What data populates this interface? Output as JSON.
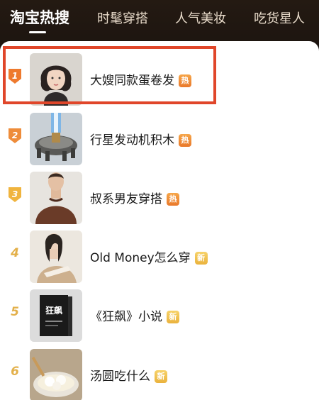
{
  "tabs": [
    {
      "label": "淘宝热搜"
    },
    {
      "label": "时髦穿搭"
    },
    {
      "label": "人气美妆"
    },
    {
      "label": "吃货星人"
    }
  ],
  "items": [
    {
      "rank": "1",
      "title": "大嫂同款蛋卷发",
      "badge": "热",
      "badge_type": "hot",
      "thumb_icon": "woman-portrait-icon"
    },
    {
      "rank": "2",
      "title": "行星发动机积木",
      "badge": "热",
      "badge_type": "hot",
      "thumb_icon": "rocket-engine-icon"
    },
    {
      "rank": "3",
      "title": "叔系男友穿搭",
      "badge": "热",
      "badge_type": "hot",
      "thumb_icon": "man-sweater-icon"
    },
    {
      "rank": "4",
      "title": "Old Money怎么穿",
      "badge": "新",
      "badge_type": "new",
      "thumb_icon": "fashion-model-icon"
    },
    {
      "rank": "5",
      "title": "《狂飙》小说",
      "badge": "新",
      "badge_type": "new",
      "thumb_icon": "book-cover-icon"
    },
    {
      "rank": "6",
      "title": "汤圆吃什么",
      "badge": "新",
      "badge_type": "new",
      "thumb_icon": "rice-ball-soup-icon"
    }
  ],
  "colors": {
    "header_bg": "#1d1510",
    "badge_hot": "#ee8a34",
    "badge_new": "#efc04a",
    "highlight": "#e0462a",
    "rank_plain": "#e3b04a"
  },
  "book_cover_text": "狂飙"
}
